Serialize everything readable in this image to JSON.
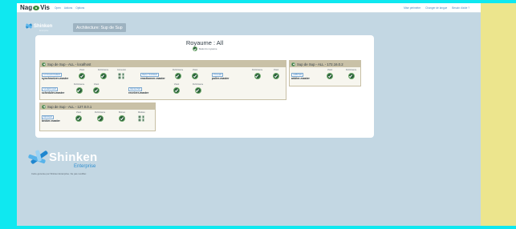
{
  "topbar": {
    "logo_pre": "Nag",
    "logo_post": "Vis",
    "menu": [
      "Open",
      "Actions",
      "Options"
    ],
    "right": [
      "Mise périmètre",
      "Changer de langue",
      "Besoin d'aide ?"
    ]
  },
  "brand_small": {
    "name": "Shinken",
    "sub": "Enterprise"
  },
  "arch_button": "Architecture: Sup de Sup",
  "panel": {
    "title": "Royaume : All",
    "status_label": "Statut du royaume"
  },
  "realms": [
    {
      "title": "Sup de Sup - ALL - localhost",
      "nodes": [
        {
          "type": "SYNCHRONIZER",
          "name": "synchronizer-master",
          "cols": [
            "Vivant",
            "Performance",
            "Connexion"
          ],
          "icons": [
            "check",
            "check",
            "quad"
          ]
        },
        {
          "type": "REACTIONNER",
          "name": "reactionner-master",
          "cols": [
            "Performance",
            "Vivant"
          ],
          "icons": [
            "check",
            "check"
          ]
        },
        {
          "type": "POLLER",
          "name": "poller-master",
          "cols": [
            "Performance",
            "Vivant"
          ],
          "icons": [
            "check",
            "check"
          ]
        },
        {
          "type": "SCHEDULER",
          "name": "scheduler-master",
          "cols": [
            "Performance",
            "Vivant"
          ],
          "icons": [
            "check",
            "check"
          ]
        },
        {
          "type": "RECEIVER",
          "name": "receiver-master",
          "cols": [
            "Vivant",
            "Performance"
          ],
          "icons": [
            "check",
            "check"
          ]
        }
      ]
    },
    {
      "title": "Sup de Sup - ALL - 172.16.0.2",
      "nodes": [
        {
          "type": "ARBITER",
          "name": "arbiter-master",
          "cols": [
            "Vivant",
            "Performance"
          ],
          "icons": [
            "check",
            "check"
          ]
        }
      ]
    },
    {
      "title": "Sup de Sup - ALL - 127.0.0.1",
      "nodes": [
        {
          "type": "BROKER",
          "name": "broker-master",
          "cols": [
            "Vivant",
            "Performance",
            "Bonnes",
            "Modules"
          ],
          "icons": [
            "check",
            "check",
            "check",
            "quad"
          ]
        }
      ]
    }
  ],
  "brand_big": {
    "name": "Shinken",
    "edition": "Enterprise",
    "tagline": "Carte générée par Shinken Enterprise. Ne pas modifier."
  },
  "colors": {
    "ok_green": "#2a5f3a",
    "realm_header": "#c9c1a7",
    "link_blue": "#4b88c1"
  }
}
